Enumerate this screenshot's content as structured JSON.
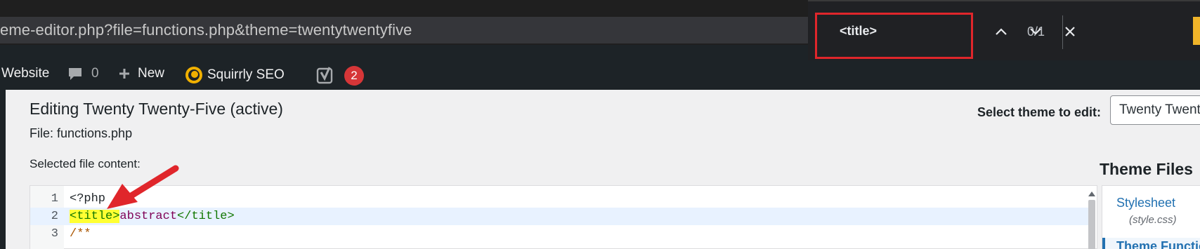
{
  "browser": {
    "url": "eme-editor.php?file=functions.php&theme=twentytwentyfive"
  },
  "find_bar": {
    "query": "<title>",
    "count": "0/1",
    "prev_icon": "chevron-up-icon",
    "next_icon": "chevron-down-icon",
    "close_icon": "close-icon"
  },
  "admin_bar": {
    "site_label": "Website",
    "comments_count": "0",
    "new_label": "New",
    "seo_label": "Squirrly SEO",
    "yoast_badge": "2"
  },
  "page": {
    "title": "Editing Twenty Twenty-Five (active)",
    "file_label": "File: functions.php",
    "select_theme_label": "Select theme to edit:",
    "selected_theme": "Twenty Twenty-Five",
    "content_label": "Selected file content:",
    "theme_files_title": "Theme Files"
  },
  "editor": {
    "lines": [
      {
        "number": "1",
        "text": "<?php"
      },
      {
        "number": "2",
        "highlight": "<title>",
        "rest_attr": "abstract",
        "rest_tag": "</title>"
      },
      {
        "number": "3",
        "text": "/**"
      }
    ]
  },
  "theme_files": {
    "items": [
      {
        "label": "Stylesheet",
        "sub": "(style.css)"
      },
      {
        "label": "Theme Functions"
      }
    ]
  },
  "colors": {
    "highlight": "#ffff33",
    "find_outline": "#e0262b",
    "link": "#2271b1",
    "badge": "#d63638"
  }
}
